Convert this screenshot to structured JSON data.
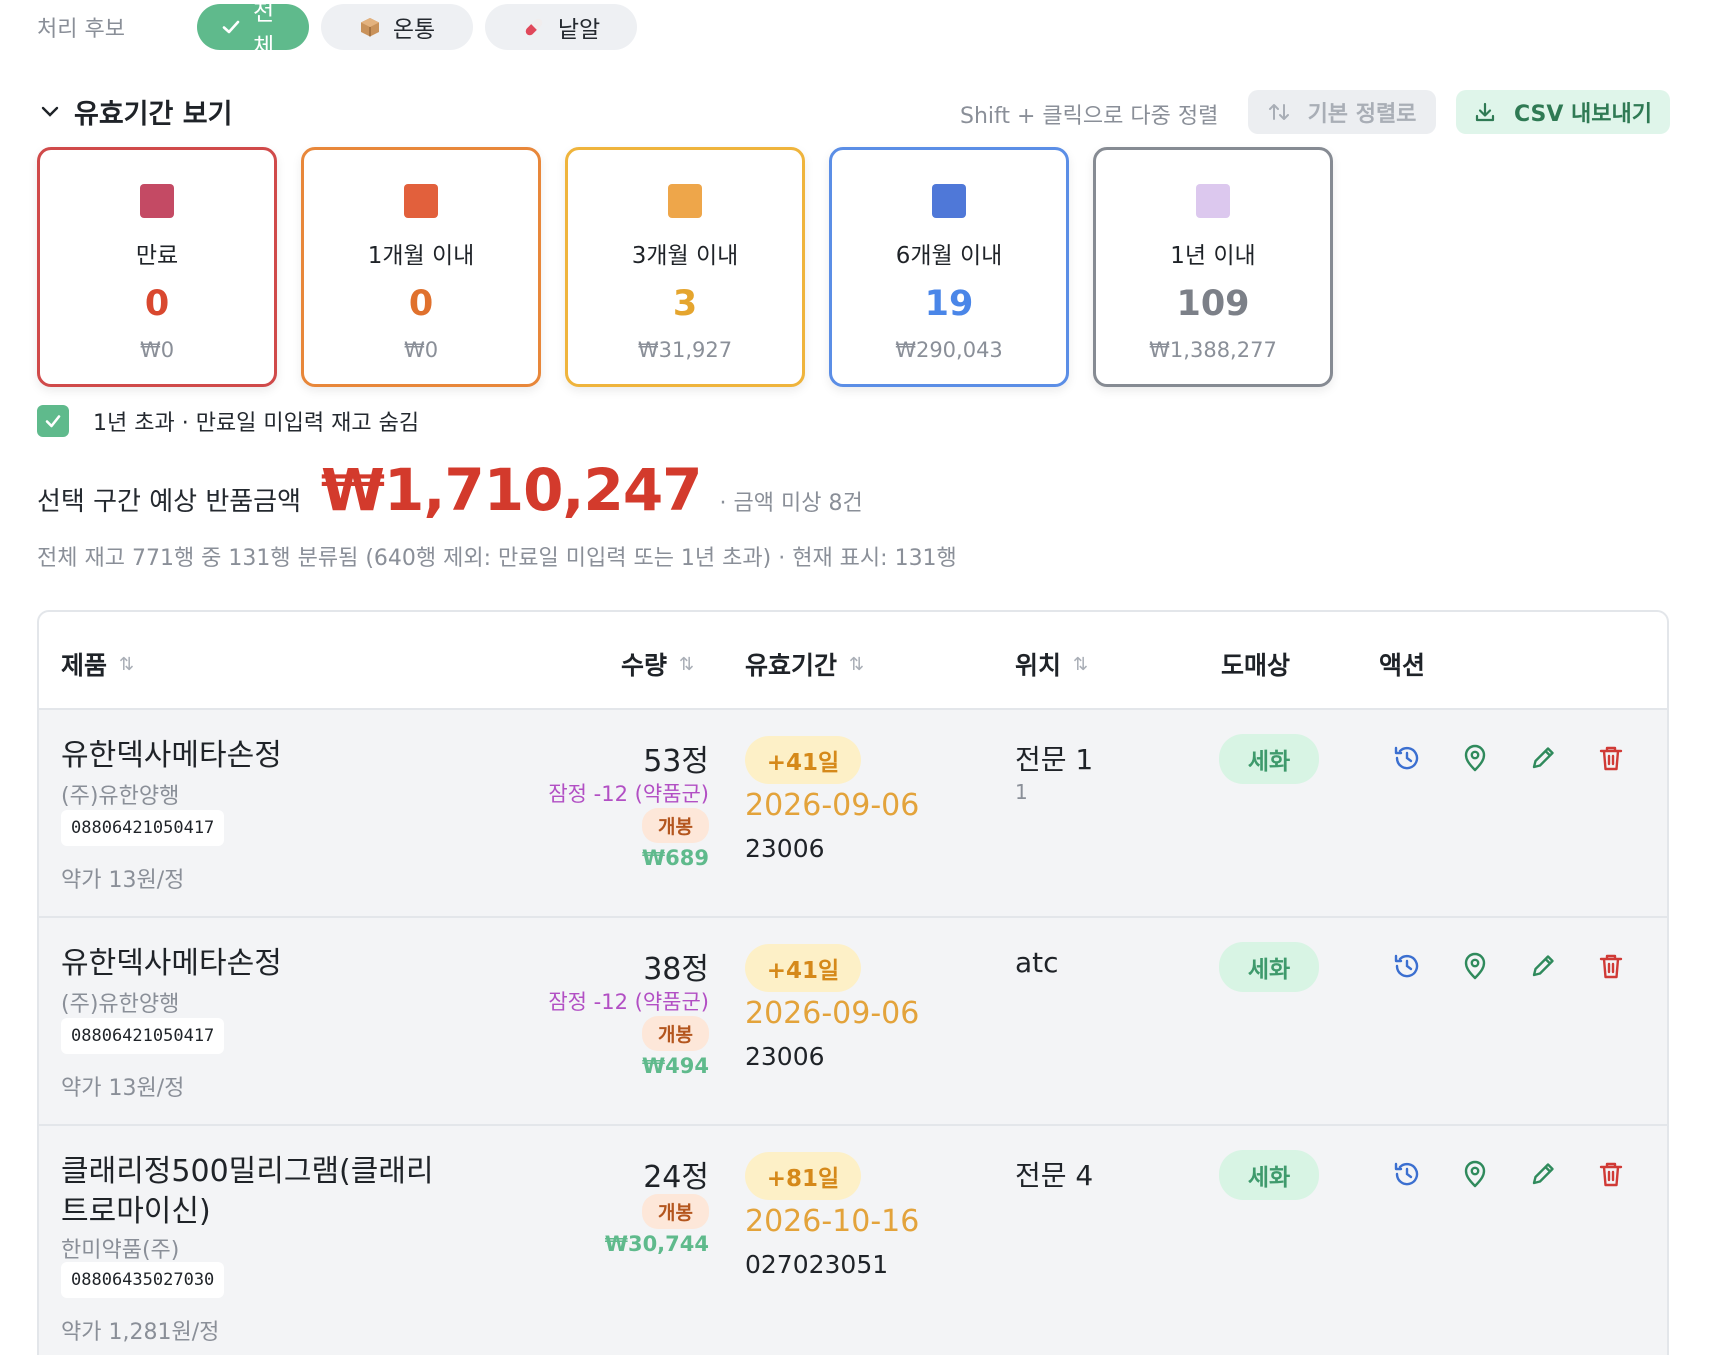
{
  "filters": {
    "label": "처리 후보",
    "chips": [
      {
        "label": "전체",
        "icon": "check-icon",
        "active": true
      },
      {
        "label": "온통",
        "icon": "box-icon",
        "active": false
      },
      {
        "label": "낱알",
        "icon": "pill-icon",
        "active": false
      }
    ]
  },
  "expiry": {
    "title": "유효기간 보기",
    "sort_hint": "Shift + 클릭으로 다중 정렬",
    "default_sort_label": "기본 정렬로",
    "csv_label": "CSV 내보내기",
    "cards": [
      {
        "label": "만료",
        "count": "0",
        "amount": "₩0",
        "color": "#d04a4a",
        "square": "#c44a64",
        "count_color": "#d9482f"
      },
      {
        "label": "1개월 이내",
        "count": "0",
        "amount": "₩0",
        "color": "#e8873a",
        "square": "#e2603c",
        "count_color": "#e0712d"
      },
      {
        "label": "3개월 이내",
        "count": "3",
        "amount": "₩31,927",
        "color": "#efb43c",
        "square": "#eea64a",
        "count_color": "#e5a52e"
      },
      {
        "label": "6개월 이내",
        "count": "19",
        "amount": "₩290,043",
        "color": "#5b8ee6",
        "square": "#4f78d8",
        "count_color": "#4a86e8"
      },
      {
        "label": "1년 이내",
        "count": "109",
        "amount": "₩1,388,277",
        "color": "#868b93",
        "square": "#dcc8ee",
        "count_color": "#7c8088"
      }
    ]
  },
  "hide_option": {
    "label": "1년 초과 · 만료일 미입력 재고 숨김",
    "checked": true
  },
  "total": {
    "label": "선택 구간 예상 반품금액",
    "amount": "₩1,710,247",
    "note": "· 금액 미상 8건"
  },
  "summary": "전체 재고 771행 중 131행 분류됨 (640행 제외: 만료일 미입력 또는 1년 초과) · 현재 표시: 131행",
  "table": {
    "headers": {
      "product": "제품",
      "qty": "수량",
      "expiry": "유효기간",
      "location": "위치",
      "wholesaler": "도매상",
      "actions": "액션"
    },
    "rows": [
      {
        "name": "유한덱사메타손정",
        "maker": "(주)유한양행",
        "code": "08806421050417",
        "unit_price": "약가 13원/정",
        "qty": "53정",
        "loss": "잠정 -12 (약품군)",
        "open": "개봉",
        "value": "₩689",
        "days": "+41일",
        "date": "2026-09-06",
        "lot": "23006",
        "location": "전문 1",
        "location_sub": "1",
        "wholesaler": "세화"
      },
      {
        "name": "유한덱사메타손정",
        "maker": "(주)유한양행",
        "code": "08806421050417",
        "unit_price": "약가 13원/정",
        "qty": "38정",
        "loss": "잠정 -12 (약품군)",
        "open": "개봉",
        "value": "₩494",
        "days": "+41일",
        "date": "2026-09-06",
        "lot": "23006",
        "location": "atc",
        "location_sub": "",
        "wholesaler": "세화"
      },
      {
        "name_line1": "클래리정500밀리그램(클래리",
        "name_line2": "트로마이신)",
        "maker": "한미약품(주)",
        "code": "08806435027030",
        "unit_price": "약가 1,281원/정",
        "qty": "24정",
        "open": "개봉",
        "value": "₩30,744",
        "days": "+81일",
        "date": "2026-10-16",
        "lot": "027023051",
        "location": "전문 4",
        "wholesaler": "세화"
      }
    ]
  }
}
